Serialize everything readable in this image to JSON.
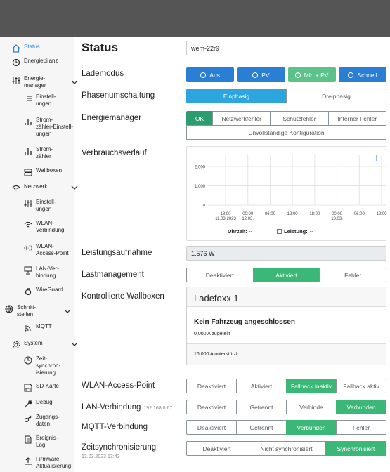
{
  "sidebar": {
    "items": [
      {
        "label": "Status",
        "icon": "home-icon",
        "active": true
      },
      {
        "label": "Energiebilanz",
        "icon": "history-icon"
      },
      {
        "label": "Energie-\nmanager",
        "icon": "sliders-icon",
        "expandable": true
      },
      {
        "label": "Einstell-\nungen",
        "icon": "list-icon",
        "sub": true
      },
      {
        "label": "Strom-\nzähler-Einstell-\nungen",
        "icon": "meter-icon",
        "sub": true
      },
      {
        "label": "Strom-\nzähler",
        "icon": "meter-icon",
        "sub": true
      },
      {
        "label": "Wallboxen",
        "icon": "wallbox-icon",
        "sub": true
      },
      {
        "label": "Netzwerk",
        "icon": "wifi-icon",
        "expandable": true
      },
      {
        "label": "Einstell-\nungen",
        "icon": "sliders-icon",
        "sub": true
      },
      {
        "label": "WLAN-\nVerbindung",
        "icon": "wifi-icon",
        "sub": true
      },
      {
        "label": "WLAN-\nAccess-Point",
        "icon": "antenna-icon",
        "sub": true
      },
      {
        "label": "LAN-Ver-\nbindung",
        "icon": "lan-icon",
        "sub": true
      },
      {
        "label": "WireGuard",
        "icon": "wireguard-icon",
        "sub": true
      },
      {
        "label": "Schnitt-\nstellen",
        "icon": "globe-icon",
        "expandable": true
      },
      {
        "label": "MQTT",
        "icon": "rss-icon",
        "sub": true
      },
      {
        "label": "System",
        "icon": "gear-icon",
        "expandable": true
      },
      {
        "label": "Zeit-\nsynchron-\nisierung",
        "icon": "clock-icon",
        "sub": true
      },
      {
        "label": "SD-Karte",
        "icon": "save-icon",
        "sub": true
      },
      {
        "label": "Debug",
        "icon": "tool-icon",
        "sub": true
      },
      {
        "label": "Zugangs-\ndaten",
        "icon": "key-icon",
        "sub": true
      },
      {
        "label": "Ereignis-\nLog",
        "icon": "file-icon",
        "sub": true
      },
      {
        "label": "Firmware-\nAktualisierung",
        "icon": "upload-icon",
        "sub": true
      }
    ]
  },
  "page": {
    "title": "Status",
    "device_name": "wem-22r9"
  },
  "rows": {
    "lademodus": {
      "label": "Lademodus",
      "buttons": [
        "Aus",
        "PV",
        "Min + PV",
        "Schnell"
      ]
    },
    "phasen": {
      "label": "Phasenumschaltung",
      "buttons": [
        "Einphasig",
        "Dreiphasig"
      ]
    },
    "energiemanager": {
      "label": "Energiemanager",
      "buttons": [
        "OK",
        "Netzwerkfehler",
        "Schützfehler",
        "Interner Fehler"
      ],
      "extra": "Unvollständige Konfiguration"
    },
    "verbrauch": {
      "label": "Verbrauchsverlauf"
    },
    "leistung": {
      "label": "Leistungsaufnahme",
      "value": "1.576 W"
    },
    "lastmanagement": {
      "label": "Lastmanagement",
      "buttons": [
        "Deaktiviert",
        "Aktiviert",
        "Fehler"
      ]
    },
    "wallboxen": {
      "label": "Kontrollierte Wallboxen"
    },
    "wlan_ap": {
      "label": "WLAN-Access-Point",
      "buttons": [
        "Deaktiviert",
        "Aktiviert",
        "Fallback inaktiv",
        "Fallback aktiv"
      ]
    },
    "lan": {
      "label": "LAN-Verbindung",
      "ip": "192.168.0.67",
      "buttons": [
        "Deaktiviert",
        "Getrennt",
        "Verbinde",
        "Verbunden"
      ]
    },
    "mqtt": {
      "label": "MQTT-Verbindung",
      "buttons": [
        "Deaktiviert",
        "Getrennt",
        "Verbunden",
        "Fehler"
      ]
    },
    "zeit": {
      "label": "Zeitsynchronisierung",
      "timestamp": "13.03.2023 13:43",
      "buttons": [
        "Deaktiviert",
        "Nicht synchronisiert",
        "Synchronisiert"
      ]
    }
  },
  "chart_data": {
    "type": "line",
    "title": "",
    "xlabel": "",
    "ylabel": "",
    "y_ticks": [
      "2.000",
      "1.000",
      "0"
    ],
    "x_ticks": [
      {
        "time": "18:00",
        "date": "11.03.2023"
      },
      {
        "time": "00:00",
        "date": "12.03."
      },
      {
        "time": "06:00",
        "date": ""
      },
      {
        "time": "12:00",
        "date": ""
      },
      {
        "time": "18:00",
        "date": ""
      },
      {
        "time": "00:00",
        "date": "13.03."
      },
      {
        "time": "06:00",
        "date": ""
      },
      {
        "time": "12:00",
        "date": ""
      }
    ],
    "legend": [
      {
        "label": "Uhrzeit:",
        "value": "--"
      },
      {
        "label": "Leistung:",
        "value": "--"
      }
    ],
    "series": [],
    "grid": true
  },
  "wallbox_card": {
    "name": "Ladefoxx 1",
    "status": "Kein Fahrzeug angeschlossen",
    "allocated": "0,000 A zugeteilt",
    "supported": "16,000 A unterstützt"
  },
  "colors": {
    "primary": "#2a7fd4",
    "success": "#2d9d6e",
    "topbar": "#555555"
  }
}
